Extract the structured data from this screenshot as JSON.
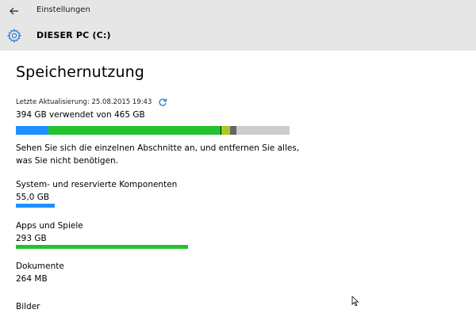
{
  "window": {
    "app_title": "Einstellungen"
  },
  "header": {
    "section": "DIESER PC (C:)",
    "icon": "gear-icon"
  },
  "main": {
    "title": "Speichernutzung",
    "last_update": "Letzte Aktualisierung: 25.08.2015 19:43",
    "used_summary": "394 GB verwendet von 465 GB",
    "description": "Sehen Sie sich die einzelnen Abschnitte an, und entfernen Sie alles, was Sie nicht benötigen.",
    "storage_bar": {
      "total_gb": 465,
      "background_color": "#cccccc",
      "segments": [
        {
          "category": "System- und reservierte Komponenten",
          "size_gb": 55,
          "color": "#1e90ff"
        },
        {
          "category": "Apps und Spiele",
          "size_gb": 293,
          "color": "#22c32e"
        },
        {
          "category": "",
          "size_gb": 1.5,
          "color": "#111111"
        },
        {
          "category": "",
          "size_gb": 15,
          "color": "#a6cc22"
        },
        {
          "category": "",
          "size_gb": 10,
          "color": "#666666"
        }
      ]
    },
    "categories": [
      {
        "name": "System- und reservierte Komponenten",
        "size": "55,0 GB",
        "fraction_of_max": 0.142,
        "color": "#1e90ff"
      },
      {
        "name": "Apps und Spiele",
        "size": "293 GB",
        "fraction_of_max": 0.63,
        "color": "#22c32e"
      },
      {
        "name": "Dokumente",
        "size": "264 MB",
        "fraction_of_max": 0,
        "color": "#1e90ff"
      },
      {
        "name": "Bilder",
        "size": "",
        "fraction_of_max": 0,
        "color": "#1e90ff"
      }
    ]
  }
}
